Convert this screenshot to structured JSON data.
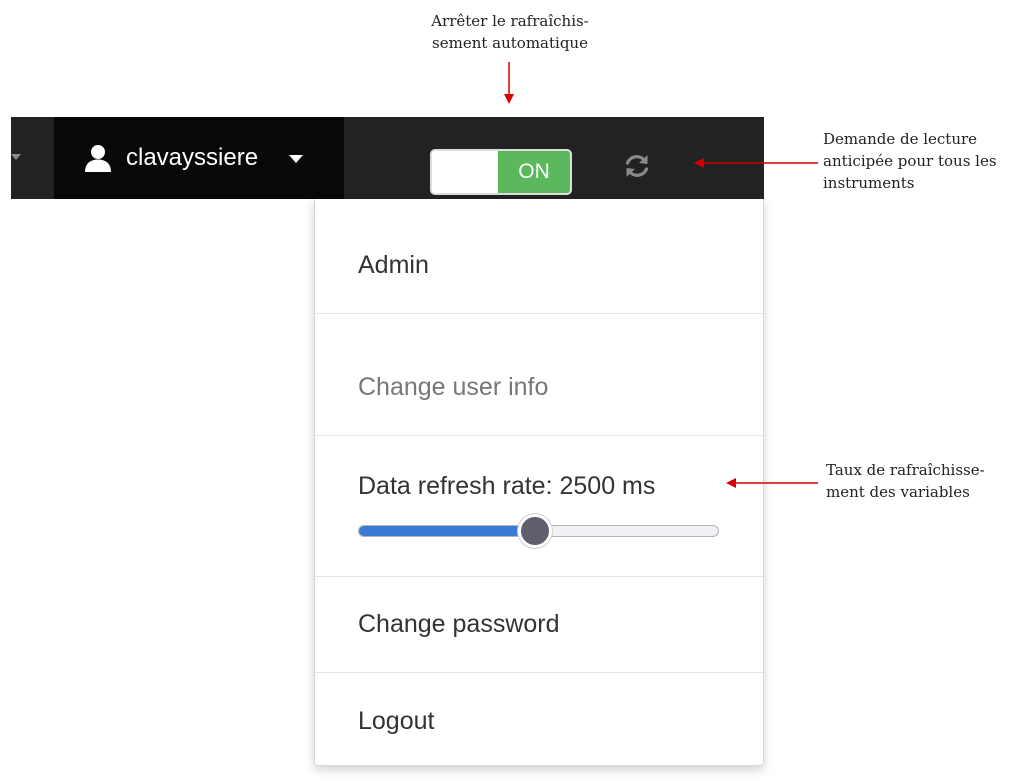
{
  "annotations": {
    "top_line1": "Arrêter le rafraîchis-",
    "top_line2": "sement automatique",
    "right1_line1": "Demande de lecture",
    "right1_line2": "anticipée pour tous les",
    "right1_line3": "instruments",
    "right2_line1": "Taux de rafraîchisse-",
    "right2_line2": "ment des variables",
    "arrow_color": "#d40000"
  },
  "navbar": {
    "username": "clavayssiere",
    "user_icon": "user-icon",
    "toggle_label": "ON",
    "toggle_state": "on",
    "refresh_icon": "refresh-icon",
    "background": "#222222",
    "toggle_on_color": "#5cb85c"
  },
  "dropdown": {
    "admin": "Admin",
    "change_user_info": "Change user info",
    "data_refresh_label": "Data refresh rate: 2500 ms",
    "change_password": "Change password",
    "logout": "Logout"
  },
  "refresh_slider": {
    "level": 0.49,
    "accent": "#3a7bd5"
  }
}
